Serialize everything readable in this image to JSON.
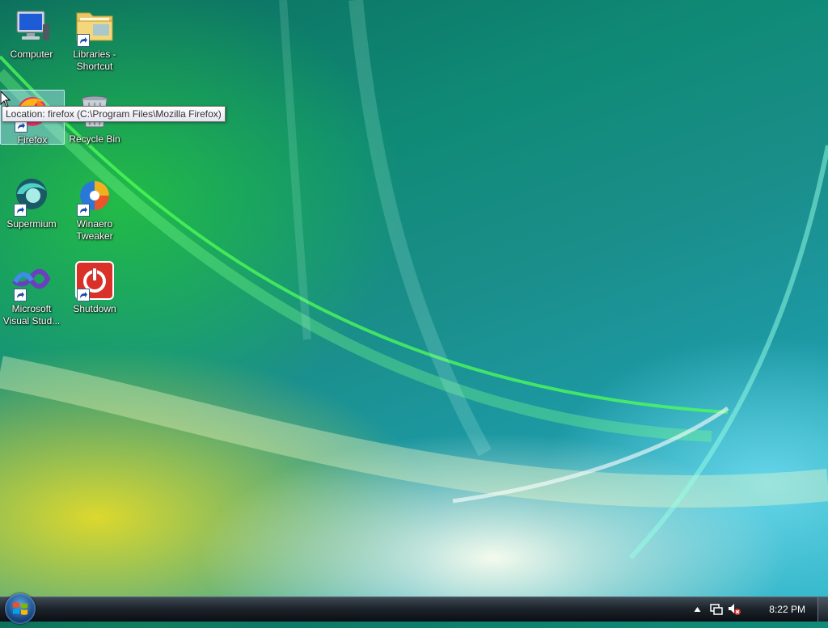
{
  "desktop": {
    "icons": [
      {
        "label": "Computer"
      },
      {
        "label": "Libraries -\nShortcut"
      },
      {
        "label": "Firefox"
      },
      {
        "label": "Recycle Bin"
      },
      {
        "label": "Supermium"
      },
      {
        "label": "Winaero\nTweaker"
      },
      {
        "label": "Microsoft\nVisual Stud..."
      },
      {
        "label": "Shutdown"
      }
    ],
    "tooltip": "Location: firefox (C:\\Program Files\\Mozilla Firefox)"
  },
  "taskbar": {
    "clock": "8:22 PM"
  },
  "icon_names": {
    "computer": "computer-icon",
    "libraries": "folder-icon",
    "firefox": "firefox-icon",
    "recycle": "recycle-bin-icon",
    "supermium": "supermium-icon",
    "winaero": "winaero-icon",
    "visualstudio": "visual-studio-icon",
    "shutdown": "power-icon"
  },
  "colors": {
    "taskbar": "#1d242b",
    "selection": "#b4dcfa",
    "shutdown_red": "#d9302a"
  }
}
